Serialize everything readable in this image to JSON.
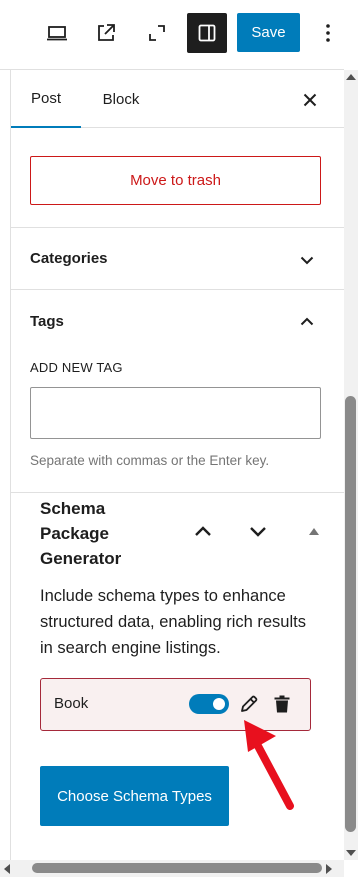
{
  "toolbar": {
    "save_label": "Save",
    "icons": [
      "desktop-preview-icon",
      "external-link-icon",
      "fullscreen-icon",
      "sidebar-toggle-icon",
      "more-options-icon"
    ]
  },
  "tabs": {
    "post_label": "Post",
    "block_label": "Block",
    "active": "Post"
  },
  "trash": {
    "label": "Move to trash"
  },
  "categories": {
    "title": "Categories",
    "expanded": false
  },
  "tags": {
    "title": "Tags",
    "expanded": true,
    "add_label": "ADD NEW TAG",
    "input_value": "",
    "help": "Separate with commas or the Enter key."
  },
  "schema": {
    "title": "Schema Package Generator",
    "description": "Include schema types to enhance structured data, enabling rich results in search engine listings.",
    "items": [
      {
        "label": "Book",
        "enabled": true
      }
    ],
    "choose_label": "Choose Schema Types"
  },
  "colors": {
    "accent": "#007cba",
    "danger": "#cc1818",
    "item_border": "#a5293a",
    "item_bg": "#f9f0f0",
    "annotation_arrow": "#e8101e"
  }
}
